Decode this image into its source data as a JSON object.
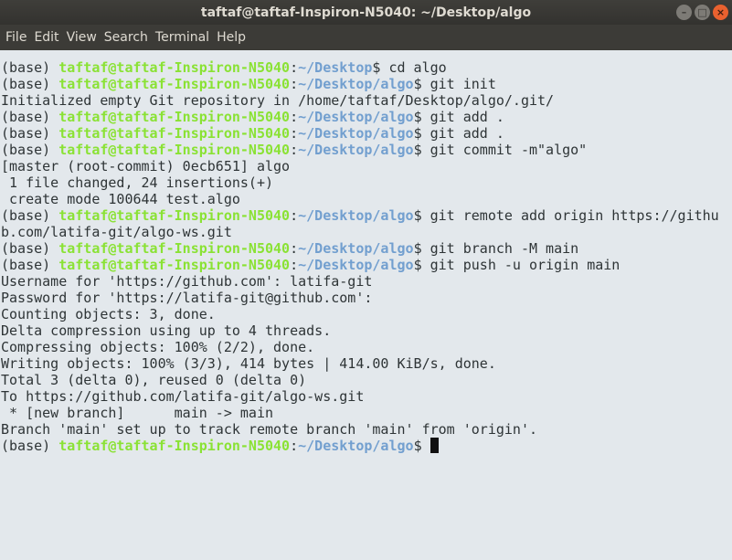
{
  "window": {
    "title": "taftaf@taftaf-Inspiron-N5040: ~/Desktop/algo",
    "buttons": [
      "minimize-icon",
      "maximize-icon",
      "close-icon"
    ]
  },
  "menu": [
    "File",
    "Edit",
    "View",
    "Search",
    "Terminal",
    "Help"
  ],
  "colors": {
    "background": "#e3e8ec",
    "user": "#8ae234",
    "path": "#729fcf",
    "text": "#2e3436"
  },
  "prompt": {
    "env": "(base) ",
    "user": "taftaf@taftaf-Inspiron-N5040",
    "sep": ":"
  },
  "lines": [
    {
      "type": "prompt",
      "path": "~/Desktop",
      "cmd": "$ cd algo"
    },
    {
      "type": "prompt",
      "path": "~/Desktop/algo",
      "cmd": "$ git init"
    },
    {
      "type": "out",
      "text": "Initialized empty Git repository in /home/taftaf/Desktop/algo/.git/"
    },
    {
      "type": "prompt",
      "path": "~/Desktop/algo",
      "cmd": "$ git add ."
    },
    {
      "type": "prompt",
      "path": "~/Desktop/algo",
      "cmd": "$ git add ."
    },
    {
      "type": "prompt",
      "path": "~/Desktop/algo",
      "cmd": "$ git commit -m\"algo\""
    },
    {
      "type": "out",
      "text": "[master (root-commit) 0ecb651] algo"
    },
    {
      "type": "out",
      "text": " 1 file changed, 24 insertions(+)"
    },
    {
      "type": "out",
      "text": " create mode 100644 test.algo"
    },
    {
      "type": "prompt",
      "path": "~/Desktop/algo",
      "cmd": "$ git remote add origin https://github.com/latifa-git/algo-ws.git"
    },
    {
      "type": "prompt",
      "path": "~/Desktop/algo",
      "cmd": "$ git branch -M main"
    },
    {
      "type": "prompt",
      "path": "~/Desktop/algo",
      "cmd": "$ git push -u origin main"
    },
    {
      "type": "out",
      "text": "Username for 'https://github.com': latifa-git"
    },
    {
      "type": "out",
      "text": "Password for 'https://latifa-git@github.com':"
    },
    {
      "type": "out",
      "text": "Counting objects: 3, done."
    },
    {
      "type": "out",
      "text": "Delta compression using up to 4 threads."
    },
    {
      "type": "out",
      "text": "Compressing objects: 100% (2/2), done."
    },
    {
      "type": "out",
      "text": "Writing objects: 100% (3/3), 414 bytes | 414.00 KiB/s, done."
    },
    {
      "type": "out",
      "text": "Total 3 (delta 0), reused 0 (delta 0)"
    },
    {
      "type": "out",
      "text": "To https://github.com/latifa-git/algo-ws.git"
    },
    {
      "type": "out",
      "text": " * [new branch]      main -> main"
    },
    {
      "type": "out",
      "text": "Branch 'main' set up to track remote branch 'main' from 'origin'."
    },
    {
      "type": "prompt",
      "path": "~/Desktop/algo",
      "cmd": "$ ",
      "cursor": true
    }
  ]
}
